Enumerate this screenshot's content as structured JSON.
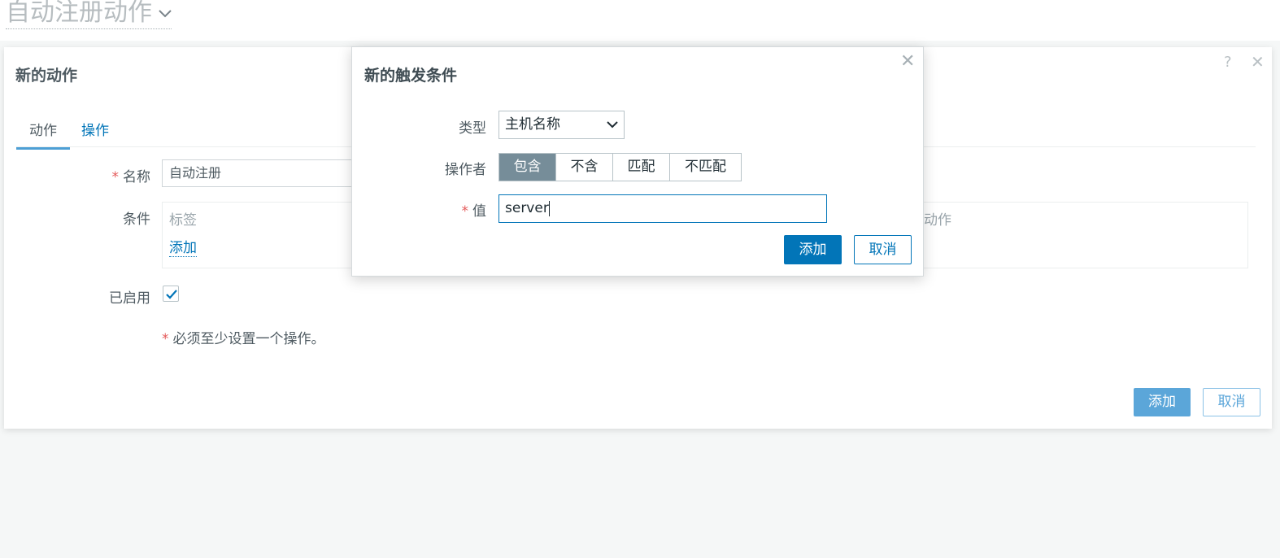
{
  "page": {
    "title": "自动注册动作"
  },
  "main_dialog": {
    "title": "新的动作",
    "help_glyph": "?",
    "close_glyph": "✕",
    "tabs": [
      {
        "label": "动作",
        "active": true
      },
      {
        "label": "操作",
        "active": false
      }
    ],
    "name_label": "名称",
    "name_value": "自动注册",
    "conditions_label": "条件",
    "conditions_col_label": "标签",
    "conditions_col_action": "动作",
    "conditions_add": "添加",
    "enabled_label": "已启用",
    "enabled_checked": true,
    "note": "必须至少设置一个操作。",
    "add_button": "添加",
    "cancel_button": "取消"
  },
  "condition_dialog": {
    "title": "新的触发条件",
    "close_glyph": "✕",
    "type_label": "类型",
    "type_value": "主机名称",
    "operator_label": "操作者",
    "operators": [
      "包含",
      "不含",
      "匹配",
      "不匹配"
    ],
    "operator_selected": "包含",
    "value_label": "值",
    "value_input": "server",
    "add_button": "添加",
    "cancel_button": "取消"
  },
  "colors": {
    "accent": "#0275b8",
    "required": "#e45959",
    "selected_segment": "#768d99"
  },
  "icons": [
    "chevron-down-icon",
    "help-icon",
    "close-icon",
    "checkmark-icon"
  ]
}
